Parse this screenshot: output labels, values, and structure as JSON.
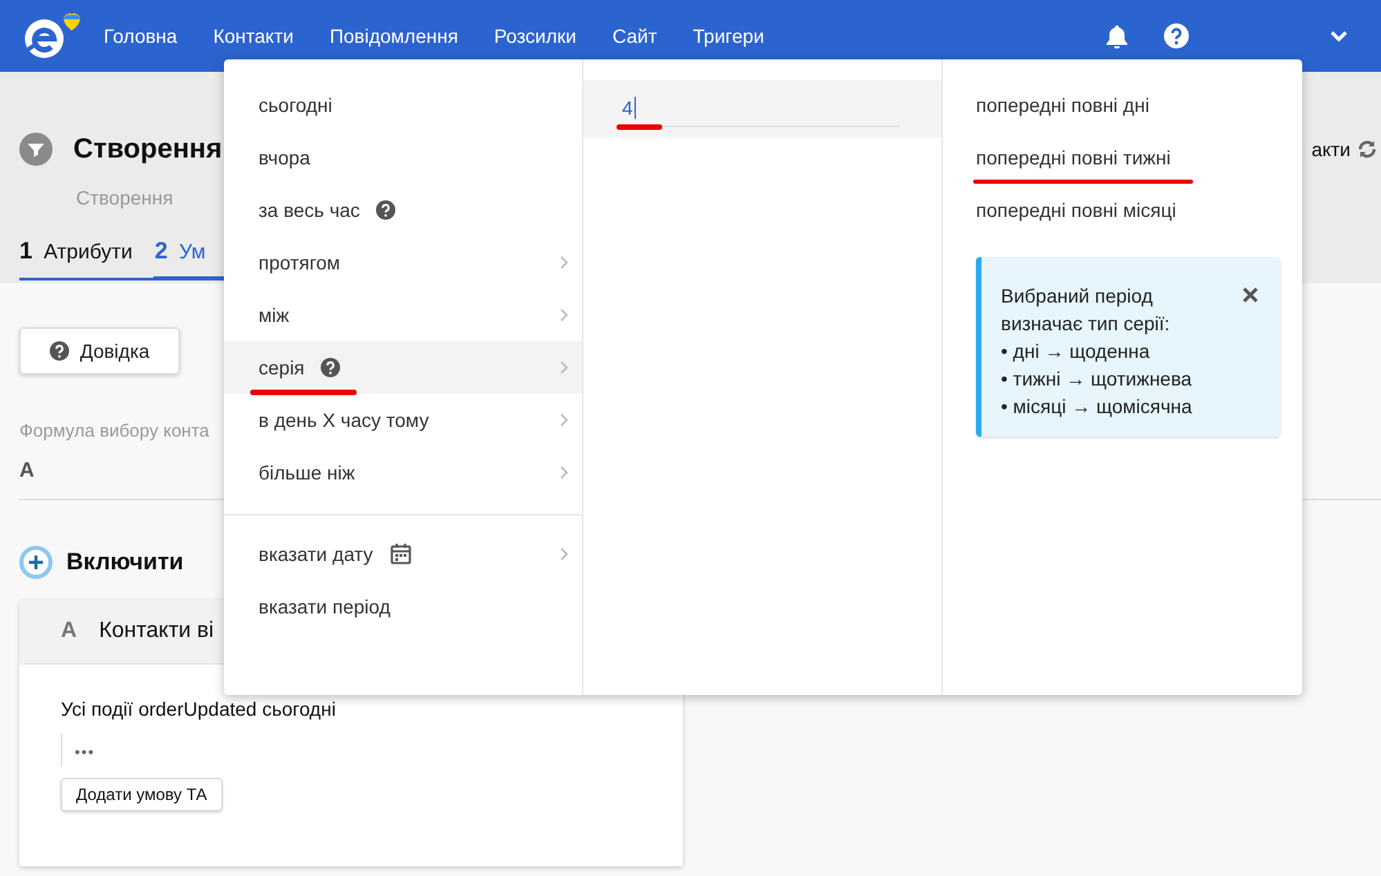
{
  "header": {
    "nav": [
      {
        "label": "Головна"
      },
      {
        "label": "Контакти"
      },
      {
        "label": "Повідомлення"
      },
      {
        "label": "Розсилки"
      },
      {
        "label": "Сайт"
      },
      {
        "label": "Тригери"
      }
    ]
  },
  "page": {
    "title": "Створення",
    "subtitle": "Створення",
    "side_link": "акти",
    "steps": [
      {
        "number": "1",
        "label": "Атрибути",
        "selected": false
      },
      {
        "number": "2",
        "label": "Ум",
        "selected": true
      }
    ]
  },
  "help_button": "Довідка",
  "formula": {
    "label": "Формула вибору конта",
    "value": "A"
  },
  "include": {
    "label": "Включити"
  },
  "card": {
    "letter": "A",
    "title": "Контакти ві",
    "condition": "Усі події orderUpdated  сьогодні",
    "more": "•••",
    "add_button": "Додати умову ТА"
  },
  "period_menu": {
    "option_groups": [
      [
        {
          "label": "сьогодні",
          "kind": "plain",
          "help": false,
          "submenu": false,
          "selected": false,
          "marked": false
        },
        {
          "label": "вчора",
          "kind": "plain",
          "help": false,
          "submenu": false,
          "selected": false,
          "marked": false
        },
        {
          "label": "за весь час",
          "kind": "plain",
          "help": true,
          "submenu": false,
          "selected": false,
          "marked": false
        },
        {
          "label": "протягом",
          "kind": "plain",
          "help": false,
          "submenu": true,
          "selected": false,
          "marked": false
        },
        {
          "label": "між",
          "kind": "plain",
          "help": false,
          "submenu": true,
          "selected": false,
          "marked": false
        },
        {
          "label": "серія",
          "kind": "plain",
          "help": true,
          "submenu": true,
          "selected": true,
          "marked": true
        },
        {
          "label": "в день X часу тому",
          "kind": "plain",
          "help": false,
          "submenu": true,
          "selected": false,
          "marked": false
        },
        {
          "label": "більше ніж",
          "kind": "plain",
          "help": false,
          "submenu": true,
          "selected": false,
          "marked": false
        }
      ],
      [
        {
          "label": "вказати дату",
          "kind": "date",
          "help": false,
          "submenu": true,
          "selected": false,
          "marked": false
        },
        {
          "label": "вказати період",
          "kind": "plain",
          "help": false,
          "submenu": false,
          "selected": false,
          "marked": false
        }
      ]
    ],
    "count_input": {
      "value": "4",
      "marked": true
    },
    "period_types": [
      {
        "label": "попередні повні дні",
        "marked": false
      },
      {
        "label": "попередні повні тижні",
        "marked": true
      },
      {
        "label": "попередні повні місяці",
        "marked": false
      }
    ],
    "info": {
      "text": "Вибраний період визначає тип серії:",
      "bullets": [
        "• дні → щоденна",
        "• тижні → щотижнева",
        "• місяці → щомісячна"
      ]
    }
  }
}
